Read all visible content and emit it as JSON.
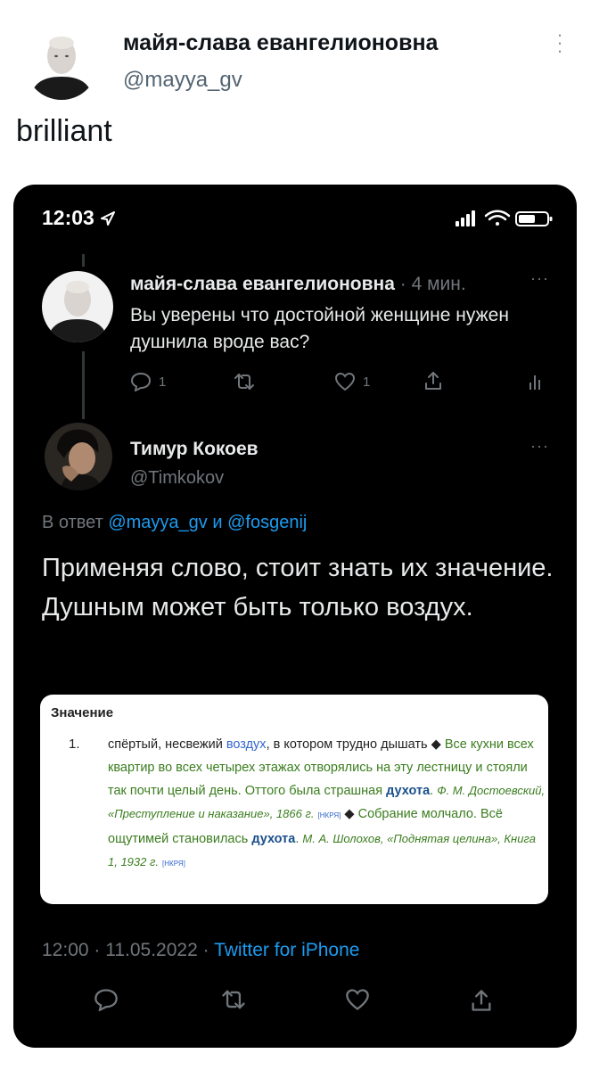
{
  "outer": {
    "display_name": "майя-слава евангелионовна",
    "handle": "@mayya_gv",
    "text": "brilliant"
  },
  "screenshot": {
    "status_time": "12:03",
    "tweet1": {
      "display_name": "майя-слава евангелионовна",
      "time_ago": "· 4 мин.",
      "text": "Вы уверены что достойной женщине нужен душнила вроде вас?",
      "reply_count": "1",
      "like_count": "1"
    },
    "tweet2": {
      "display_name": "Тимур Кокоев",
      "handle": "@Timkokov",
      "reply_prefix": "В ответ",
      "reply_user1": "@mayya_gv",
      "reply_and": "и",
      "reply_user2": "@fosgenij",
      "text": "Применяя слово, стоит знать их значение. Душным может быть только воздух.",
      "timestamp": "12:00 · 11.05.2022 ·",
      "source": "Twitter for iPhone"
    },
    "dictionary": {
      "heading": "Значение",
      "number": "1.",
      "def_start": "спёртый, несвежий",
      "def_link": "воздух",
      "def_end": ", в котором трудно дышать",
      "diamond": "◆",
      "ex1_part1": "Все кухни всех квартир во всех четырех этажах отворялись на эту лестницу и стояли так почти целый день. Оттого была страшная",
      "ex1_word": "духота",
      "ex1_src": "Ф. М. Достоевский, «Преступление и наказание», 1866 г.",
      "nkrya": "[НКРЯ]",
      "ex2_part1": "Собрание молчало. Всё ощутимей становилась",
      "ex2_word": "духота",
      "ex2_src": "М. А. Шолохов, «Поднятая целина», Книга 1, 1932 г."
    }
  },
  "colors": {
    "link": "#1d9bf0",
    "muted": "#71767b",
    "background_dark": "#000000",
    "dict_green": "#3a7d1e"
  }
}
